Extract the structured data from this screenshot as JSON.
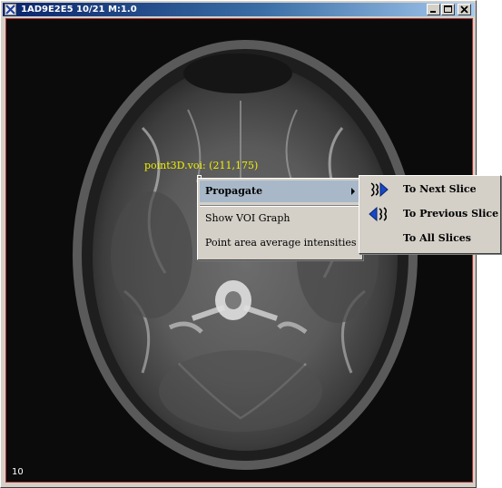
{
  "window": {
    "title": "1AD9E2E5  10/21 M:1.0",
    "controls": [
      "minimize-icon",
      "maximize-icon",
      "close-icon"
    ]
  },
  "canvas": {
    "voi_label": "point3D.voi: (211,175)",
    "slice_number": "10"
  },
  "context_menu": {
    "items": [
      {
        "label": "Propagate",
        "selected": true,
        "has_submenu": true
      },
      {
        "label": "Show VOI Graph"
      },
      {
        "label": "Point area average intensities"
      }
    ]
  },
  "submenu": {
    "items": [
      {
        "label": "To Next Slice",
        "icon": "next-slice-icon"
      },
      {
        "label": "To Previous Slice",
        "icon": "previous-slice-icon"
      },
      {
        "label": "To All Slices",
        "icon": ""
      }
    ]
  },
  "colors": {
    "titlebar_start": "#0a246a",
    "titlebar_end": "#a6caf0",
    "menu_highlight": "#a9b8c9",
    "voi_label": "#f0f000",
    "canvas_border": "#b03030"
  }
}
